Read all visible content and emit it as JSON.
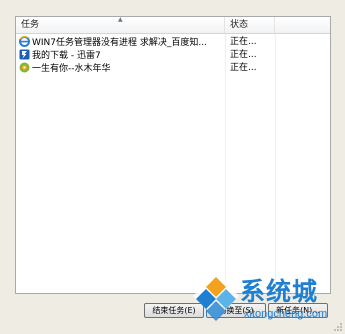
{
  "table": {
    "columns": {
      "task": "任务",
      "status": "状态"
    },
    "rows": [
      {
        "icon": "ie-browser-icon",
        "task": "WIN7任务管理器没有进程 求解决_百度知...",
        "status": "正在..."
      },
      {
        "icon": "thunder-download-icon",
        "task": "我的下载 - 迅雷7",
        "status": "正在..."
      },
      {
        "icon": "media-player-icon",
        "task": "一生有你--水木年华",
        "status": "正在..."
      }
    ]
  },
  "buttons": {
    "end_task": "结束任务(E)",
    "switch_to": "切换至(S)",
    "new_task": "新任务(N)..."
  },
  "watermark": {
    "title": "系统城",
    "url": "xitongcheng.com"
  },
  "colors": {
    "watermark_blue": "#1f7fd0",
    "dialog_bg": "#efece4",
    "list_bg": "#ffffff"
  }
}
